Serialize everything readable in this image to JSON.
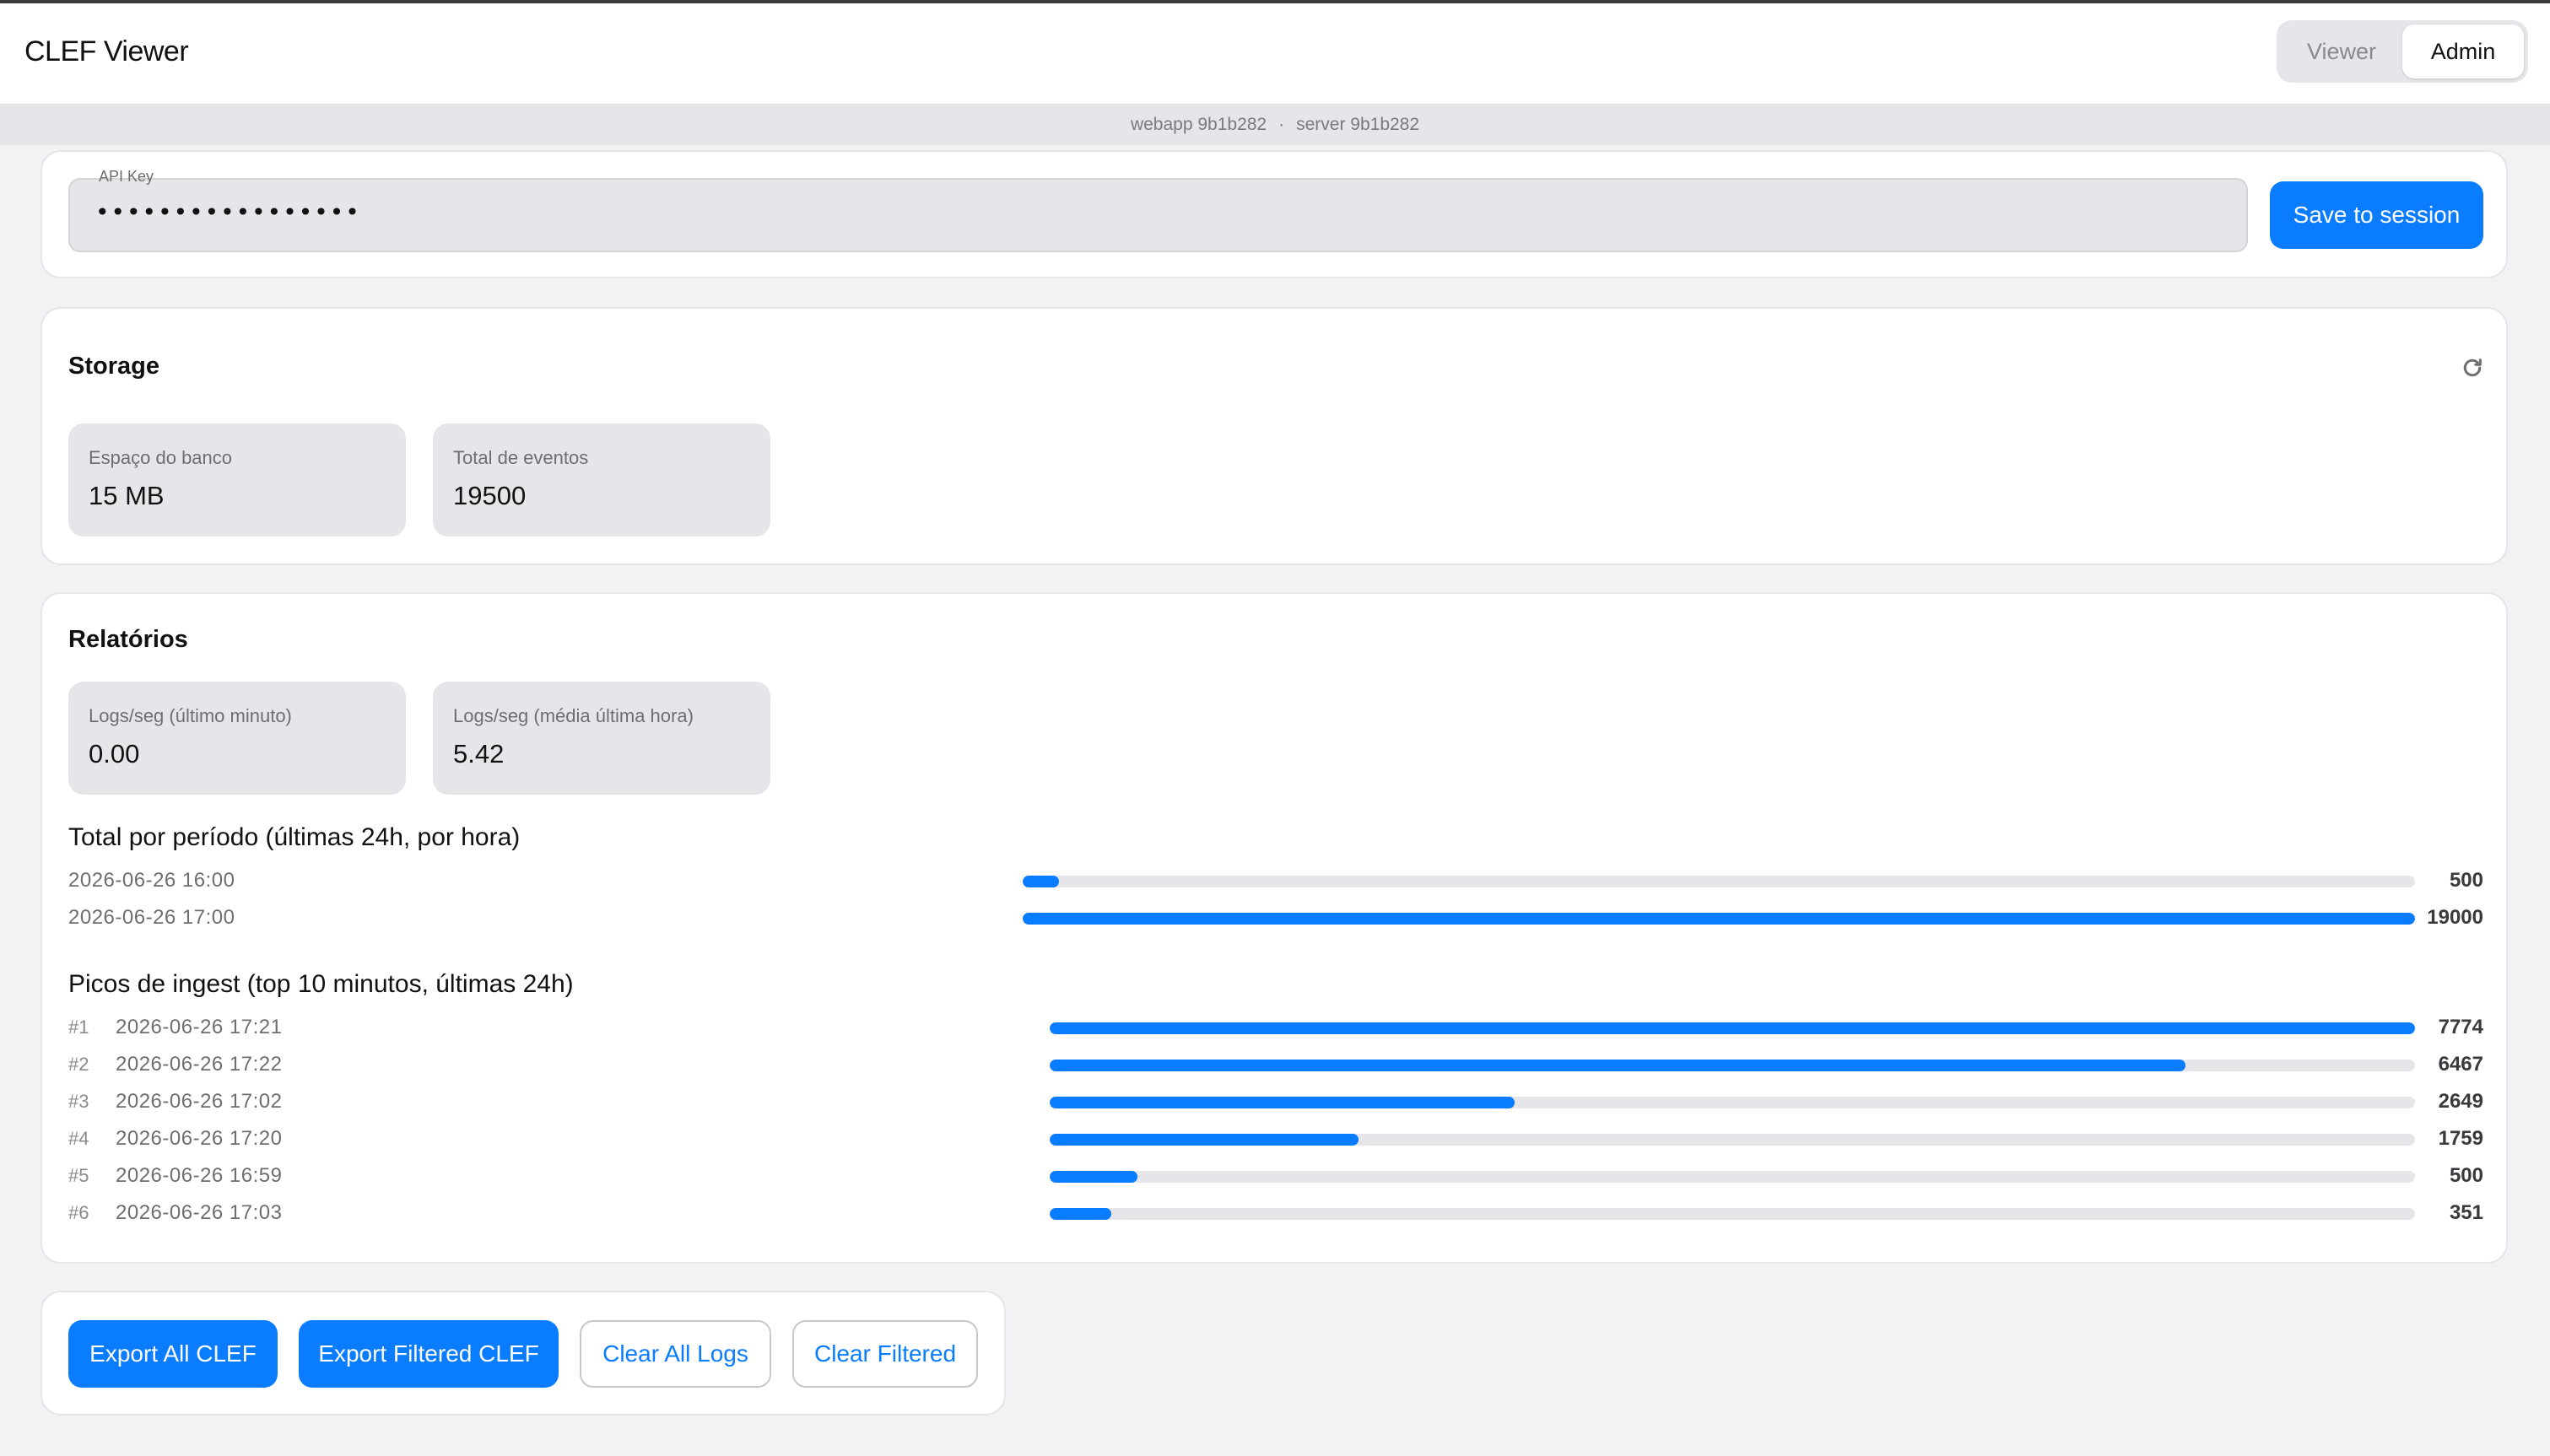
{
  "app": {
    "title": "CLEF Viewer"
  },
  "mode_switch": {
    "options": [
      "Viewer",
      "Admin"
    ],
    "selected": "Admin"
  },
  "version": {
    "webapp": "webapp 9b1b282",
    "separator": "·",
    "server": "server 9b1b282"
  },
  "api_key": {
    "label": "API Key",
    "value": "•••••••••••••••••",
    "save_label": "Save to session"
  },
  "storage": {
    "title": "Storage",
    "refresh_icon": "refresh-icon",
    "stats": [
      {
        "label": "Espaço do banco",
        "value": "15 MB"
      },
      {
        "label": "Total de eventos",
        "value": "19500"
      }
    ]
  },
  "reports": {
    "title": "Relatórios",
    "stats": [
      {
        "label": "Logs/seg (último minuto)",
        "value": "0.00"
      },
      {
        "label": "Logs/seg (média última hora)",
        "value": "5.42"
      }
    ],
    "period": {
      "title": "Total por período (últimas 24h, por hora)",
      "rows": [
        {
          "label": "2026-06-26 16:00",
          "value": 500
        },
        {
          "label": "2026-06-26 17:00",
          "value": 19000
        }
      ]
    },
    "peaks": {
      "title": "Picos de ingest (top 10 minutos, últimas 24h)",
      "rows": [
        {
          "rank": "#1",
          "label": "2026-06-26 17:21",
          "value": 7774
        },
        {
          "rank": "#2",
          "label": "2026-06-26 17:22",
          "value": 6467
        },
        {
          "rank": "#3",
          "label": "2026-06-26 17:02",
          "value": 2649
        },
        {
          "rank": "#4",
          "label": "2026-06-26 17:20",
          "value": 1759
        },
        {
          "rank": "#5",
          "label": "2026-06-26 16:59",
          "value": 500
        },
        {
          "rank": "#6",
          "label": "2026-06-26 17:03",
          "value": 351
        }
      ]
    }
  },
  "actions": {
    "export_all": "Export All CLEF",
    "export_filtered": "Export Filtered CLEF",
    "clear_all": "Clear All Logs",
    "clear_filtered": "Clear Filtered"
  },
  "colors": {
    "accent": "#0a7cff",
    "track": "#e6e6ea",
    "background": "#f2f2f4"
  }
}
